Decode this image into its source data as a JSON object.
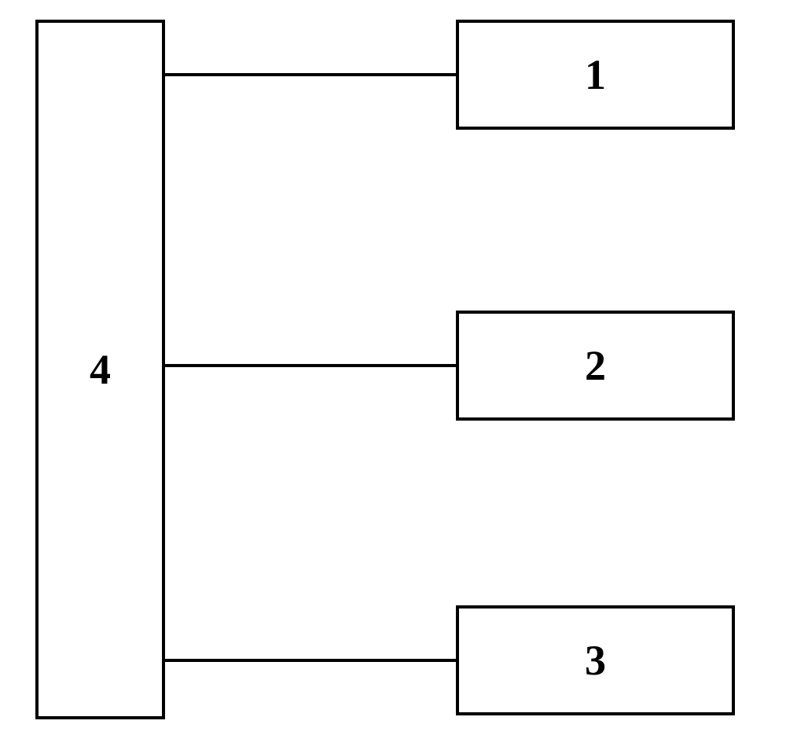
{
  "blocks": {
    "left": {
      "label": "4"
    },
    "right": [
      {
        "label": "1"
      },
      {
        "label": "2"
      },
      {
        "label": "3"
      }
    ]
  }
}
